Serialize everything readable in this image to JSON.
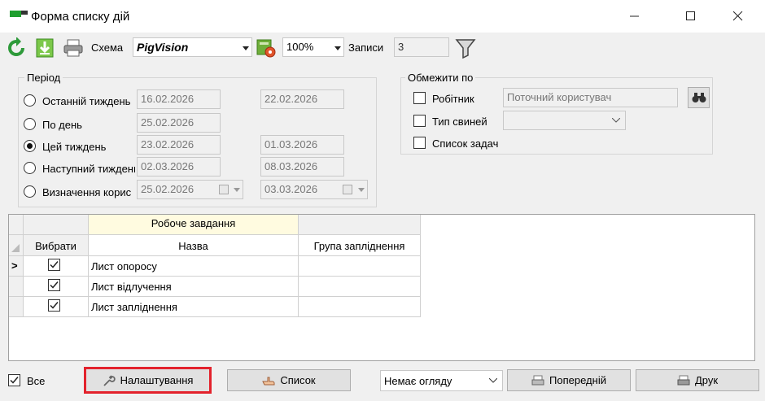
{
  "window": {
    "title": "Форма списку дій",
    "minimize_icon": "minimize-icon",
    "maximize_icon": "maximize-icon",
    "close_icon": "close-icon"
  },
  "toolbar": {
    "scheme_label": "Схема",
    "scheme_value": "PigVision",
    "zoom_value": "100%",
    "records_label": "Записи",
    "records_value": "3"
  },
  "period": {
    "title": "Період",
    "options": [
      {
        "label": "Останній тиждень",
        "from": "16.02.2026",
        "to": "22.02.2026",
        "selected": false
      },
      {
        "label": "По день",
        "from": "25.02.2026",
        "to": "",
        "selected": false
      },
      {
        "label": "Цей тиждень",
        "from": "23.02.2026",
        "to": "01.03.2026",
        "selected": true
      },
      {
        "label": "Наступний тиждень",
        "from": "02.03.2026",
        "to": "08.03.2026",
        "selected": false
      },
      {
        "label": "Визначення корис",
        "from": "25.02.2026",
        "to": "03.03.2026",
        "selected": false
      }
    ]
  },
  "restrict": {
    "title": "Обмежити по",
    "worker_label": "Робітник",
    "worker_value": "Поточний користувач",
    "pig_type_label": "Тип свиней",
    "pig_type_value": "",
    "task_list_label": "Список задач"
  },
  "grid": {
    "band_header": "Робоче завдання",
    "columns": [
      "Вибрати",
      "Назва",
      "Група запліднення"
    ],
    "rows": [
      {
        "checked": true,
        "name": "Лист опоросу",
        "group": ""
      },
      {
        "checked": true,
        "name": "Лист відлучення",
        "group": ""
      },
      {
        "checked": true,
        "name": "Лист запліднення",
        "group": ""
      }
    ],
    "current_row_marker": ">"
  },
  "footer": {
    "all_label": "Все",
    "all_checked": true,
    "settings_label": "Налаштування",
    "list_label": "Список",
    "view_value": "Немає огляду",
    "previous_label": "Попередній",
    "print_label": "Друк"
  },
  "colors": {
    "highlight": "#e3222c",
    "band_header_bg": "#fffbe0",
    "refresh_green": "#2e9a3a"
  }
}
